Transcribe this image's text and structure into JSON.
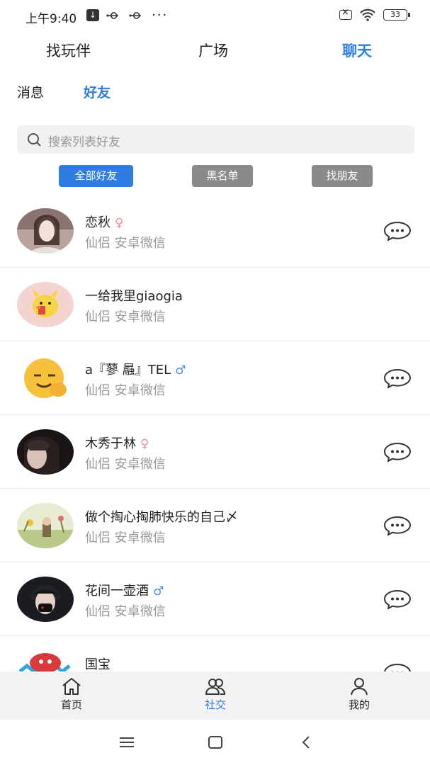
{
  "status_bar": {
    "time": "上午9:40",
    "battery": "33",
    "download_icon": "↓"
  },
  "top_tabs": [
    {
      "label": "找玩伴",
      "active": false
    },
    {
      "label": "广场",
      "active": false
    },
    {
      "label": "聊天",
      "active": true
    }
  ],
  "sub_tabs": [
    {
      "label": "消息",
      "active": false
    },
    {
      "label": "好友",
      "active": true
    }
  ],
  "search": {
    "placeholder": "搜索列表好友"
  },
  "filters": [
    {
      "label": "全部好友",
      "active": true
    },
    {
      "label": "黑名单",
      "active": false
    },
    {
      "label": "找朋友",
      "active": false
    }
  ],
  "friends": [
    {
      "name": "恋秋",
      "gender": "♀",
      "desc": "仙侣 安卓微信",
      "has_chat": true
    },
    {
      "name": "一给我里giaogia",
      "gender": "",
      "desc": "仙侣 安卓微信",
      "has_chat": false
    },
    {
      "name": "a『蓼 曧』TEL",
      "gender": "♂",
      "desc": "仙侣 安卓微信",
      "has_chat": true
    },
    {
      "name": "木秀于林",
      "gender": "♀",
      "desc": "仙侣 安卓微信",
      "has_chat": true
    },
    {
      "name": "做个掏心掏肺快乐的自己〆",
      "gender": "",
      "desc": "仙侣 安卓微信",
      "has_chat": true
    },
    {
      "name": "花间一壶酒",
      "gender": "♂",
      "desc": "仙侣 安卓微信",
      "has_chat": true
    },
    {
      "name": "国宝",
      "gender": "",
      "desc": "",
      "has_chat": true
    }
  ],
  "tab_bar": [
    {
      "label": "首页",
      "icon": "home-icon",
      "active": false
    },
    {
      "label": "社交",
      "icon": "social-icon",
      "active": true
    },
    {
      "label": "我的",
      "icon": "profile-icon",
      "active": false
    }
  ],
  "colors": {
    "accent": "#2f7de1",
    "chip_gray": "#8a8a8a",
    "female": "#f08f9a",
    "male": "#4a90e2"
  }
}
